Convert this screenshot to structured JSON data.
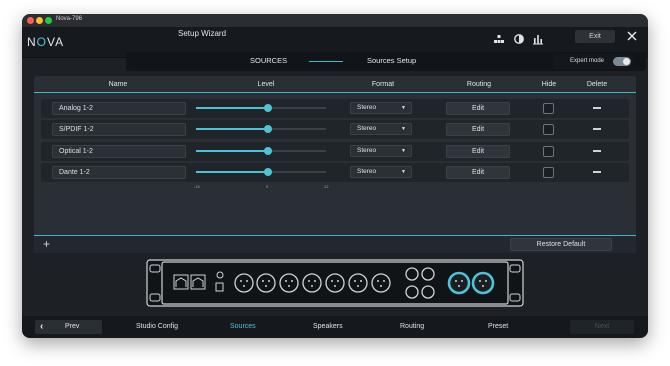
{
  "window": {
    "title": "Nova-796"
  },
  "app": {
    "logo": "NOVA",
    "title": "Setup Wizard",
    "exit_label": "Exit"
  },
  "subnav": {
    "sources": "SOURCES",
    "setup": "Sources Setup",
    "expert_mode_label": "Expert mode",
    "expert_mode_on": true
  },
  "table": {
    "headers": {
      "name": "Name",
      "level": "Level",
      "format": "Format",
      "routing": "Routing",
      "hide": "Hide",
      "delete": "Delete"
    },
    "rows": [
      {
        "name": "Analog 1-2",
        "level": 0,
        "min": "-15",
        "mid": "0",
        "max": "12",
        "format": "Stereo",
        "routing": "Edit",
        "hidden": false
      },
      {
        "name": "S/PDIF 1-2",
        "level": 0,
        "min": "-15",
        "mid": "0",
        "max": "12",
        "format": "Stereo",
        "routing": "Edit",
        "hidden": false
      },
      {
        "name": "Optical 1-2",
        "level": 0,
        "min": "-15",
        "mid": "0",
        "max": "12",
        "format": "Stereo",
        "routing": "Edit",
        "hidden": false
      },
      {
        "name": "Dante 1-2",
        "level": 0,
        "min": "-15",
        "mid": "0",
        "max": "12",
        "format": "Stereo",
        "routing": "Edit",
        "hidden": false
      }
    ],
    "add_label": "+",
    "restore_label": "Restore Default"
  },
  "footer": {
    "prev_label": "Prev",
    "steps": [
      "Studio Config",
      "Sources",
      "Speakers",
      "Routing",
      "Preset"
    ],
    "active_step": "Sources",
    "next_label": "Next"
  },
  "colors": {
    "accent": "#4ec3d6",
    "background": "#1d2126",
    "panel": "#2a2f35"
  },
  "icons": [
    "network-icon",
    "brightness-icon",
    "levels-icon",
    "close-icon",
    "chevron-left-icon",
    "dropdown-caret-icon"
  ]
}
